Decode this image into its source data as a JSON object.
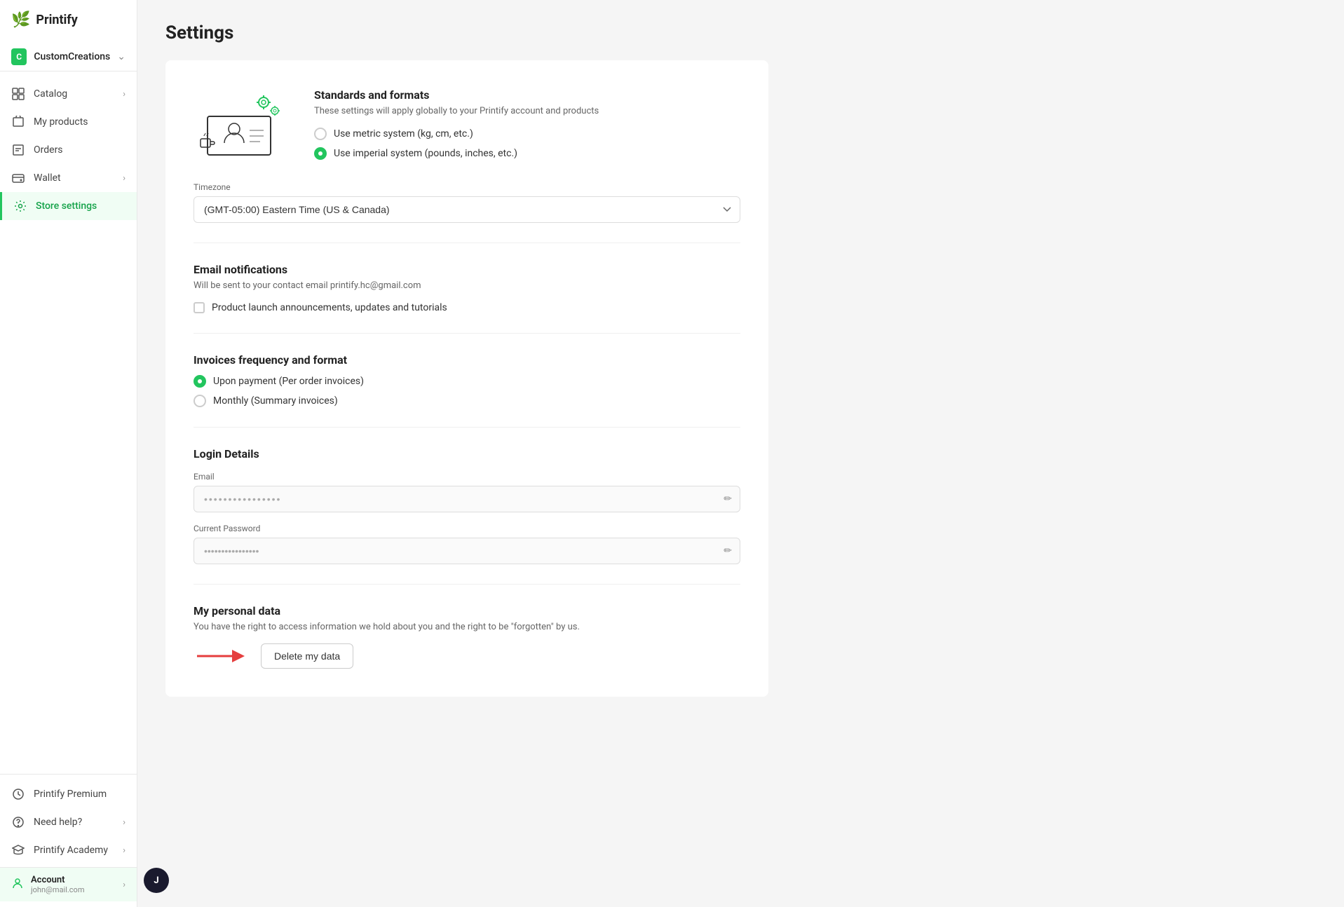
{
  "app": {
    "logo_icon": "🌿",
    "logo_text": "Printify"
  },
  "store": {
    "name": "CustomCreations",
    "chevron": "❯"
  },
  "nav": {
    "items": [
      {
        "id": "catalog",
        "label": "Catalog",
        "has_chevron": true
      },
      {
        "id": "my-products",
        "label": "My products",
        "has_chevron": false
      },
      {
        "id": "orders",
        "label": "Orders",
        "has_chevron": false
      },
      {
        "id": "wallet",
        "label": "Wallet",
        "has_chevron": true
      },
      {
        "id": "store-settings",
        "label": "Store settings",
        "has_chevron": false,
        "active": true
      }
    ],
    "bottom_items": [
      {
        "id": "printify-premium",
        "label": "Printify Premium",
        "has_chevron": false
      },
      {
        "id": "need-help",
        "label": "Need help?",
        "has_chevron": true
      },
      {
        "id": "printify-academy",
        "label": "Printify Academy",
        "has_chevron": true
      }
    ]
  },
  "account": {
    "name": "Account",
    "email": "john@mail.com",
    "avatar_initial": "J"
  },
  "page": {
    "title": "Settings"
  },
  "settings": {
    "standards": {
      "title": "Standards and formats",
      "subtitle": "These settings will apply globally to your Printify account and products",
      "metric_label": "Use metric system (kg, cm, etc.)",
      "imperial_label": "Use imperial system (pounds, inches, etc.)",
      "selected": "imperial"
    },
    "timezone": {
      "label": "Timezone",
      "value": "(GMT-05:00) Eastern Time (US & Canada)"
    },
    "email_notifications": {
      "title": "Email notifications",
      "subtitle_prefix": "Will be sent to your contact email ",
      "contact_email": "printify.hc@gmail.com",
      "checkbox_label": "Product launch announcements, updates and tutorials",
      "checked": false
    },
    "invoices": {
      "title": "Invoices frequency and format",
      "options": [
        {
          "id": "per-order",
          "label": "Upon payment (Per order invoices)",
          "selected": true
        },
        {
          "id": "monthly",
          "label": "Monthly (Summary invoices)",
          "selected": false
        }
      ]
    },
    "login_details": {
      "title": "Login Details",
      "email_label": "Email",
      "email_placeholder": "••••••••••••••••",
      "password_label": "Current Password",
      "password_placeholder": "••••••••••••••••"
    },
    "personal_data": {
      "title": "My personal data",
      "subtitle": "You have the right to access information we hold about you and the right to be \"forgotten\" by us.",
      "delete_button": "Delete my data"
    }
  }
}
